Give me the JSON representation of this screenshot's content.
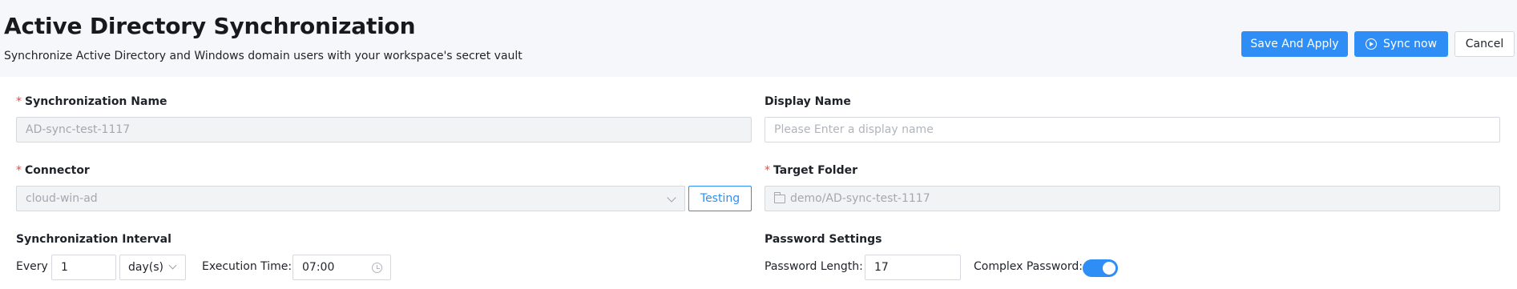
{
  "header": {
    "title": "Active Directory Synchronization",
    "subtitle": "Synchronize Active Directory and Windows domain users with your workspace's secret vault"
  },
  "actions": {
    "save_label": "Save And Apply",
    "sync_label": "Sync now",
    "cancel_label": "Cancel"
  },
  "form": {
    "sync_name": {
      "label": "Synchronization Name",
      "required": "*",
      "value": "AD-sync-test-1117"
    },
    "display_name": {
      "label": "Display Name",
      "placeholder": "Please Enter a display name",
      "value": ""
    },
    "connector": {
      "label": "Connector",
      "required": "*",
      "value": "cloud-win-ad",
      "test_label": "Testing"
    },
    "target_folder": {
      "label": "Target Folder",
      "required": "*",
      "value": "demo/AD-sync-test-1117"
    },
    "interval": {
      "label": "Synchronization Interval",
      "every_label": "Every",
      "every_value": "1",
      "unit": "day(s)",
      "exec_label": "Execution Time:",
      "exec_value": "07:00"
    },
    "password": {
      "label": "Password Settings",
      "length_label": "Password Length:",
      "length_value": "17",
      "complex_label": "Complex Password:",
      "complex_enabled": true
    }
  },
  "colors": {
    "primary": "#2f8ef5",
    "required": "#f5483b",
    "page_bg": "#f5f7fb"
  }
}
